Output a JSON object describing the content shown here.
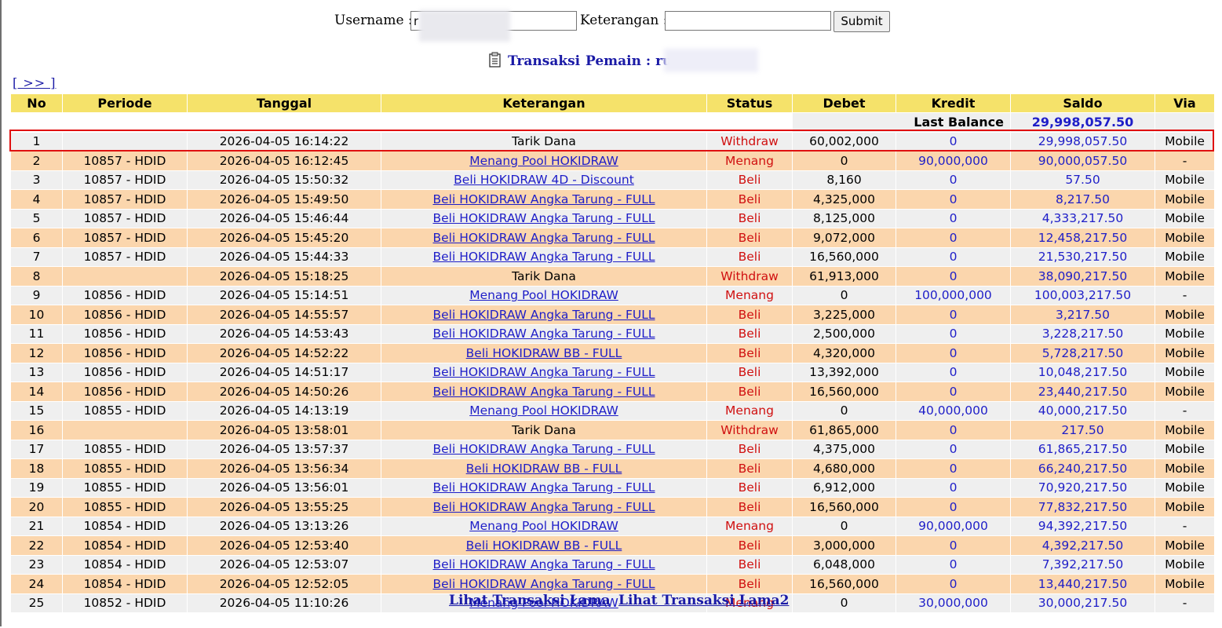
{
  "form": {
    "username_label": "Username :",
    "username_value": "r",
    "keterangan_label": "Keterangan :",
    "keterangan_value": "",
    "submit_label": "Submit"
  },
  "title": {
    "transaksi": "Transaksi",
    "pemain_label": "Pemain : ru"
  },
  "nav_next": "[ >> ]",
  "columns": [
    "No",
    "Periode",
    "Tanggal",
    "Keterangan",
    "Status",
    "Debet",
    "Kredit",
    "Saldo",
    "Via"
  ],
  "last_balance": {
    "label": "Last Balance",
    "value": "29,998,057.50"
  },
  "rows": [
    {
      "no": "1",
      "periode": "",
      "tanggal": "2026-04-05 16:14:22",
      "keterangan": "Tarik Dana",
      "link": false,
      "status": "Withdraw",
      "debet": "60,002,000",
      "kredit": "0",
      "saldo": "29,998,057.50",
      "via": "Mobile"
    },
    {
      "no": "2",
      "periode": "10857 - HDID",
      "tanggal": "2026-04-05 16:12:45",
      "keterangan": "Menang Pool HOKIDRAW",
      "link": true,
      "status": "Menang",
      "debet": "0",
      "kredit": "90,000,000",
      "saldo": "90,000,057.50",
      "via": "-"
    },
    {
      "no": "3",
      "periode": "10857 - HDID",
      "tanggal": "2026-04-05 15:50:32",
      "keterangan": "Beli HOKIDRAW 4D - Discount",
      "link": true,
      "status": "Beli",
      "debet": "8,160",
      "kredit": "0",
      "saldo": "57.50",
      "via": "Mobile"
    },
    {
      "no": "4",
      "periode": "10857 - HDID",
      "tanggal": "2026-04-05 15:49:50",
      "keterangan": "Beli HOKIDRAW Angka Tarung - FULL",
      "link": true,
      "status": "Beli",
      "debet": "4,325,000",
      "kredit": "0",
      "saldo": "8,217.50",
      "via": "Mobile"
    },
    {
      "no": "5",
      "periode": "10857 - HDID",
      "tanggal": "2026-04-05 15:46:44",
      "keterangan": "Beli HOKIDRAW Angka Tarung - FULL",
      "link": true,
      "status": "Beli",
      "debet": "8,125,000",
      "kredit": "0",
      "saldo": "4,333,217.50",
      "via": "Mobile"
    },
    {
      "no": "6",
      "periode": "10857 - HDID",
      "tanggal": "2026-04-05 15:45:20",
      "keterangan": "Beli HOKIDRAW Angka Tarung - FULL",
      "link": true,
      "status": "Beli",
      "debet": "9,072,000",
      "kredit": "0",
      "saldo": "12,458,217.50",
      "via": "Mobile"
    },
    {
      "no": "7",
      "periode": "10857 - HDID",
      "tanggal": "2026-04-05 15:44:33",
      "keterangan": "Beli HOKIDRAW Angka Tarung - FULL",
      "link": true,
      "status": "Beli",
      "debet": "16,560,000",
      "kredit": "0",
      "saldo": "21,530,217.50",
      "via": "Mobile"
    },
    {
      "no": "8",
      "periode": "",
      "tanggal": "2026-04-05 15:18:25",
      "keterangan": "Tarik Dana",
      "link": false,
      "status": "Withdraw",
      "debet": "61,913,000",
      "kredit": "0",
      "saldo": "38,090,217.50",
      "via": "Mobile"
    },
    {
      "no": "9",
      "periode": "10856 - HDID",
      "tanggal": "2026-04-05 15:14:51",
      "keterangan": "Menang Pool HOKIDRAW",
      "link": true,
      "status": "Menang",
      "debet": "0",
      "kredit": "100,000,000",
      "saldo": "100,003,217.50",
      "via": "-"
    },
    {
      "no": "10",
      "periode": "10856 - HDID",
      "tanggal": "2026-04-05 14:55:57",
      "keterangan": "Beli HOKIDRAW Angka Tarung - FULL",
      "link": true,
      "status": "Beli",
      "debet": "3,225,000",
      "kredit": "0",
      "saldo": "3,217.50",
      "via": "Mobile"
    },
    {
      "no": "11",
      "periode": "10856 - HDID",
      "tanggal": "2026-04-05 14:53:43",
      "keterangan": "Beli HOKIDRAW Angka Tarung - FULL",
      "link": true,
      "status": "Beli",
      "debet": "2,500,000",
      "kredit": "0",
      "saldo": "3,228,217.50",
      "via": "Mobile"
    },
    {
      "no": "12",
      "periode": "10856 - HDID",
      "tanggal": "2026-04-05 14:52:22",
      "keterangan": "Beli HOKIDRAW BB - FULL",
      "link": true,
      "status": "Beli",
      "debet": "4,320,000",
      "kredit": "0",
      "saldo": "5,728,217.50",
      "via": "Mobile"
    },
    {
      "no": "13",
      "periode": "10856 - HDID",
      "tanggal": "2026-04-05 14:51:17",
      "keterangan": "Beli HOKIDRAW Angka Tarung - FULL",
      "link": true,
      "status": "Beli",
      "debet": "13,392,000",
      "kredit": "0",
      "saldo": "10,048,217.50",
      "via": "Mobile"
    },
    {
      "no": "14",
      "periode": "10856 - HDID",
      "tanggal": "2026-04-05 14:50:26",
      "keterangan": "Beli HOKIDRAW Angka Tarung - FULL",
      "link": true,
      "status": "Beli",
      "debet": "16,560,000",
      "kredit": "0",
      "saldo": "23,440,217.50",
      "via": "Mobile"
    },
    {
      "no": "15",
      "periode": "10855 - HDID",
      "tanggal": "2026-04-05 14:13:19",
      "keterangan": "Menang Pool HOKIDRAW",
      "link": true,
      "status": "Menang",
      "debet": "0",
      "kredit": "40,000,000",
      "saldo": "40,000,217.50",
      "via": "-"
    },
    {
      "no": "16",
      "periode": "",
      "tanggal": "2026-04-05 13:58:01",
      "keterangan": "Tarik Dana",
      "link": false,
      "status": "Withdraw",
      "debet": "61,865,000",
      "kredit": "0",
      "saldo": "217.50",
      "via": "Mobile"
    },
    {
      "no": "17",
      "periode": "10855 - HDID",
      "tanggal": "2026-04-05 13:57:37",
      "keterangan": "Beli HOKIDRAW Angka Tarung - FULL",
      "link": true,
      "status": "Beli",
      "debet": "4,375,000",
      "kredit": "0",
      "saldo": "61,865,217.50",
      "via": "Mobile"
    },
    {
      "no": "18",
      "periode": "10855 - HDID",
      "tanggal": "2026-04-05 13:56:34",
      "keterangan": "Beli HOKIDRAW BB - FULL",
      "link": true,
      "status": "Beli",
      "debet": "4,680,000",
      "kredit": "0",
      "saldo": "66,240,217.50",
      "via": "Mobile"
    },
    {
      "no": "19",
      "periode": "10855 - HDID",
      "tanggal": "2026-04-05 13:56:01",
      "keterangan": "Beli HOKIDRAW Angka Tarung - FULL",
      "link": true,
      "status": "Beli",
      "debet": "6,912,000",
      "kredit": "0",
      "saldo": "70,920,217.50",
      "via": "Mobile"
    },
    {
      "no": "20",
      "periode": "10855 - HDID",
      "tanggal": "2026-04-05 13:55:25",
      "keterangan": "Beli HOKIDRAW Angka Tarung - FULL",
      "link": true,
      "status": "Beli",
      "debet": "16,560,000",
      "kredit": "0",
      "saldo": "77,832,217.50",
      "via": "Mobile"
    },
    {
      "no": "21",
      "periode": "10854 - HDID",
      "tanggal": "2026-04-05 13:13:26",
      "keterangan": "Menang Pool HOKIDRAW",
      "link": true,
      "status": "Menang",
      "debet": "0",
      "kredit": "90,000,000",
      "saldo": "94,392,217.50",
      "via": "-"
    },
    {
      "no": "22",
      "periode": "10854 - HDID",
      "tanggal": "2026-04-05 12:53:40",
      "keterangan": "Beli HOKIDRAW BB - FULL",
      "link": true,
      "status": "Beli",
      "debet": "3,000,000",
      "kredit": "0",
      "saldo": "4,392,217.50",
      "via": "Mobile"
    },
    {
      "no": "23",
      "periode": "10854 - HDID",
      "tanggal": "2026-04-05 12:53:07",
      "keterangan": "Beli HOKIDRAW Angka Tarung - FULL",
      "link": true,
      "status": "Beli",
      "debet": "6,048,000",
      "kredit": "0",
      "saldo": "7,392,217.50",
      "via": "Mobile"
    },
    {
      "no": "24",
      "periode": "10854 - HDID",
      "tanggal": "2026-04-05 12:52:05",
      "keterangan": "Beli HOKIDRAW Angka Tarung - FULL",
      "link": true,
      "status": "Beli",
      "debet": "16,560,000",
      "kredit": "0",
      "saldo": "13,440,217.50",
      "via": "Mobile"
    },
    {
      "no": "25",
      "periode": "10852 - HDID",
      "tanggal": "2026-04-05 11:10:26",
      "keterangan": "Menang Pool HOKIDRAW",
      "link": true,
      "status": "Menang",
      "debet": "0",
      "kredit": "30,000,000",
      "saldo": "30,000,217.50",
      "via": "-"
    }
  ],
  "footer": {
    "link1": "Lihat Transaksi Lama",
    "link2": "Lihat Transaksi Lama2"
  },
  "colors": {
    "header_bg": "#f5e26a",
    "row_odd": "#efefef",
    "row_even": "#fbd6ad",
    "link_blue": "#1e1ec8",
    "status_red": "#d01010",
    "highlight_red": "#e01010"
  },
  "icons": [
    "document-list-icon"
  ]
}
